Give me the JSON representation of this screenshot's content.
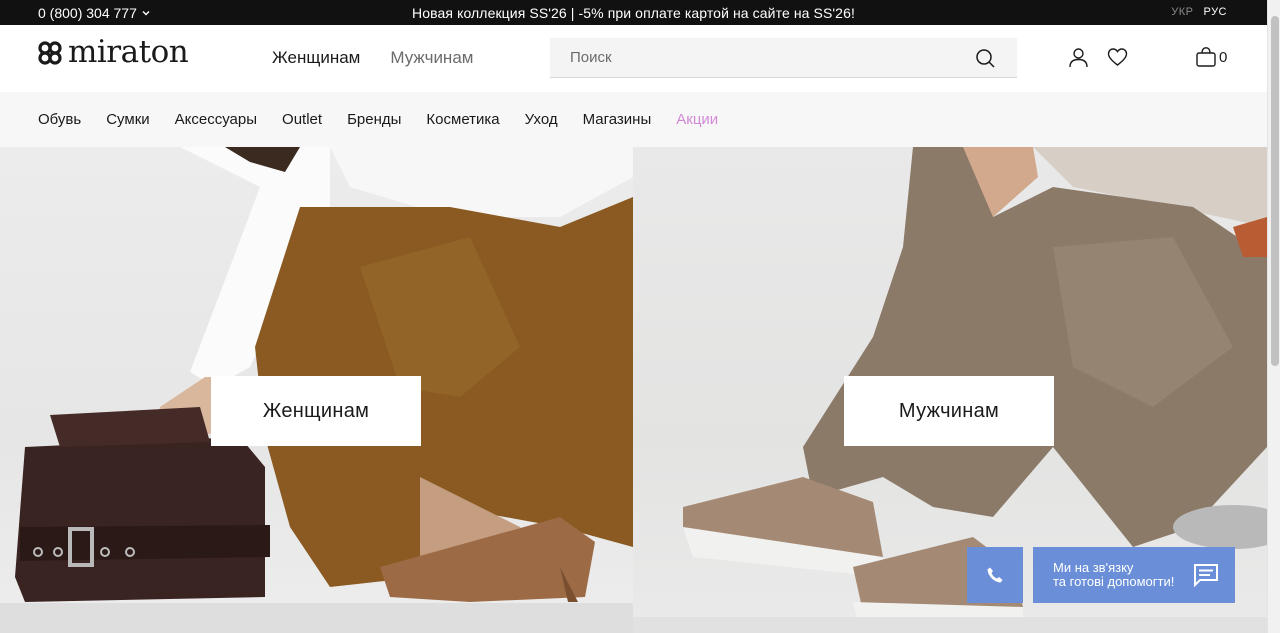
{
  "topbar": {
    "phone": "0 (800) 304 777",
    "promo": "Новая коллекция SS'26 | -5% при оплате картой на сайте на SS'26!",
    "lang_ukr": "УКР",
    "lang_rus": "РУС"
  },
  "header": {
    "logo_text": "miraton",
    "gender_nav": [
      "Женщинам",
      "Мужчинам"
    ],
    "search_placeholder": "Поиск",
    "cart_count": "0"
  },
  "catnav": {
    "items": [
      "Обувь",
      "Сумки",
      "Аксессуары",
      "Outlet",
      "Бренды",
      "Косметика",
      "Уход",
      "Магазины"
    ],
    "sale": "Акции"
  },
  "hero": {
    "women_cta": "Женщинам",
    "men_cta": "Мужчинам"
  },
  "chat": {
    "line1": "Ми на зв'язку",
    "line2": "та готові допомогти!"
  },
  "colors": {
    "topbar_bg": "#111111",
    "accent_sale": "#d08ad6",
    "chat_bg": "#6a8fd8"
  }
}
